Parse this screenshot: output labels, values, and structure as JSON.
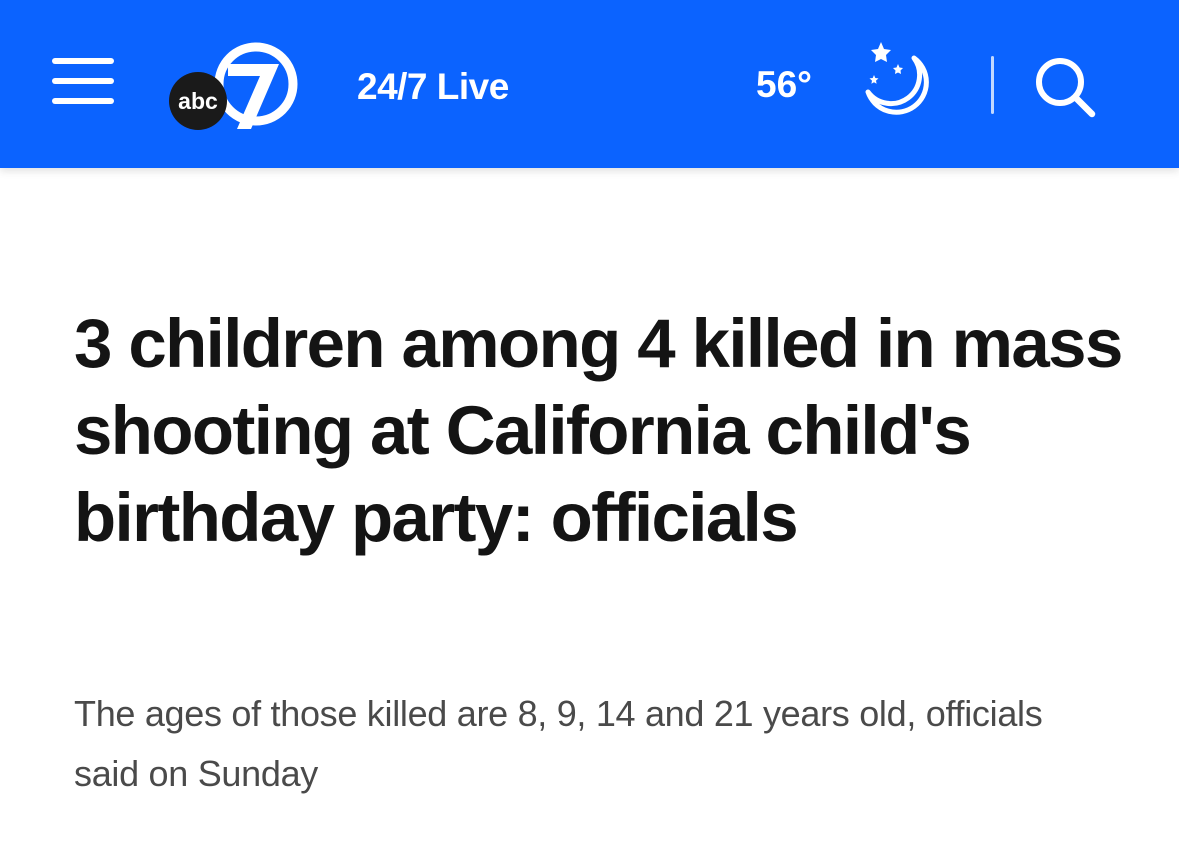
{
  "header": {
    "brand": "abc7",
    "logo": {
      "network": "abc",
      "channel": "7"
    },
    "live_label": "24/7 Live",
    "temperature": "56°",
    "weather_icon": "clear-night-moon-stars-icon",
    "menu_icon": "hamburger-menu-icon",
    "search_icon": "search-icon",
    "accent_color": "#0b63ff"
  },
  "article": {
    "headline": "3 children among 4 killed in mass shooting at California child's birthday party: officials",
    "subheadline": "The ages of those killed are 8, 9, 14 and 21 years old, officials said on Sunday"
  }
}
